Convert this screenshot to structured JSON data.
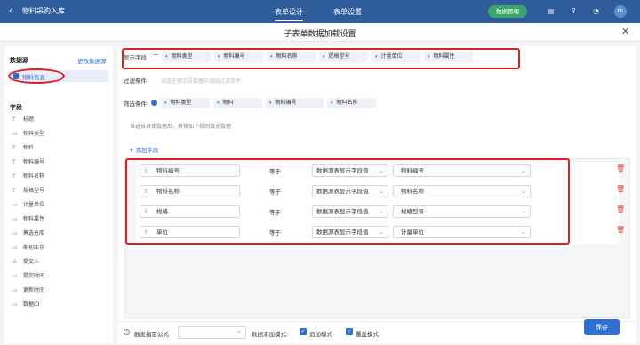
{
  "topbar": {
    "app_title": "物料采购入库",
    "tabs": [
      "表单设计",
      "表单设置"
    ],
    "data_mgmt_label": "数据管理",
    "avatar_text": "tb"
  },
  "dialog": {
    "title": "子表单数据加载设置"
  },
  "sidebar": {
    "datasource_title": "数据源",
    "change_datasource": "更改数据源",
    "selected_datasource": "物料信息",
    "fields_title": "字段",
    "fields": [
      {
        "icon": "T",
        "label": "标题"
      },
      {
        "icon": "▭",
        "label": "物料类型"
      },
      {
        "icon": "T",
        "label": "物料"
      },
      {
        "icon": "T",
        "label": "物料编号"
      },
      {
        "icon": "T",
        "label": "物料名称"
      },
      {
        "icon": "T",
        "label": "规格型号"
      },
      {
        "icon": "▭",
        "label": "计量单位"
      },
      {
        "icon": "▭",
        "label": "物料属性"
      },
      {
        "icon": "▭",
        "label": "筹选仓库"
      },
      {
        "icon": "▭",
        "label": "期初库存"
      },
      {
        "icon": "♙",
        "label": "提交人"
      },
      {
        "icon": "▭",
        "label": "提交时间"
      },
      {
        "icon": "▭",
        "label": "更新时间"
      },
      {
        "icon": "▭",
        "label": "数据ID"
      }
    ]
  },
  "display_fields": {
    "label": "显示字段",
    "chips": [
      "物料类型",
      "物料编号",
      "物料名称",
      "规格型号",
      "计量单位",
      "物料属性"
    ]
  },
  "filter_condition": {
    "label": "过滤条件",
    "placeholder": "如选左侧字段数据中调出过滤条件"
  },
  "select_condition": {
    "label": "筛选条件",
    "chips": [
      "物料类型",
      "物料",
      "物料编号",
      "物料名称"
    ]
  },
  "fill_hint": "当选择具体数据后，将按如下规则填充数据",
  "add_field_label": "+ 添加字段",
  "rules": [
    {
      "field": "物料编号",
      "op": "等于",
      "source": "数据源表显示字段值",
      "value": "物料编号"
    },
    {
      "field": "物料名称",
      "op": "等于",
      "source": "数据源表显示字段值",
      "value": "物料名称"
    },
    {
      "field": "规格",
      "op": "等于",
      "source": "数据源表显示字段值",
      "value": "规格型号"
    },
    {
      "field": "单位",
      "op": "等于",
      "source": "数据源表显示字段值",
      "value": "计量单位"
    }
  ],
  "footer": {
    "trigger_formula": "触发指定公式",
    "add_mode_label": "数据添加模式:",
    "append_mode": "追加模式",
    "overwrite_mode": "覆盖模式",
    "save_label": "保存"
  },
  "colors": {
    "topbar": "#2f5d9b",
    "accent": "#2f6fd1",
    "highlight": "#e02020",
    "data_mgmt_button": "#3aa66a"
  }
}
